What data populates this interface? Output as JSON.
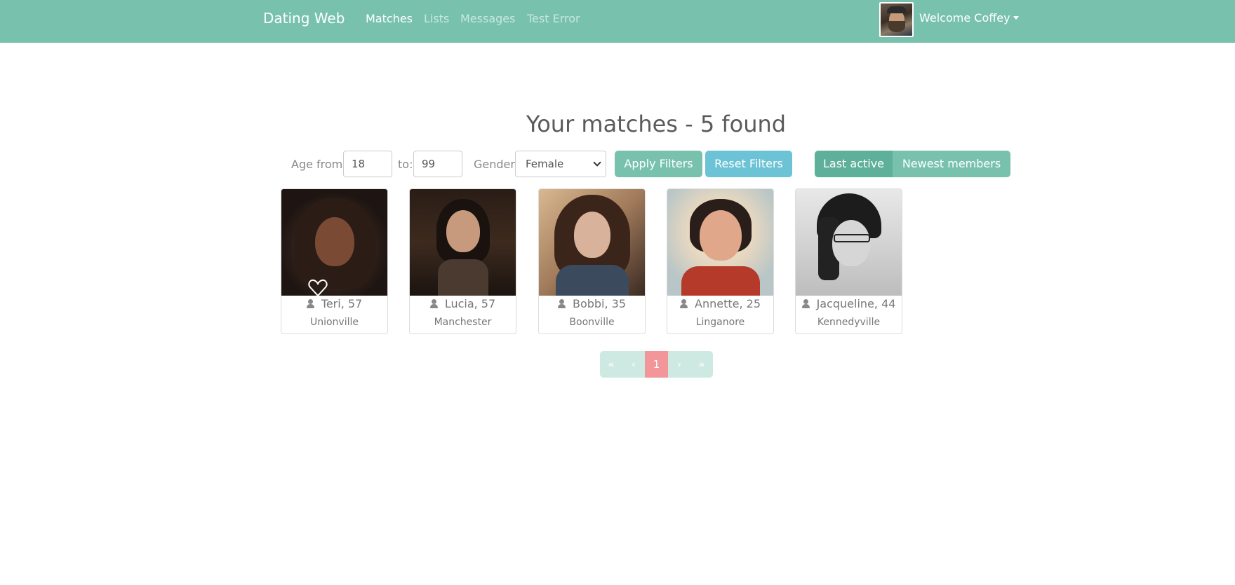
{
  "navbar": {
    "brand": "Dating Web",
    "links": [
      "Matches",
      "Lists",
      "Messages",
      "Test Error"
    ],
    "active_link": "Matches",
    "user_greeting": "Welcome Coffey"
  },
  "page": {
    "title": "Your matches - 5 found"
  },
  "filters": {
    "age_from_label": "Age from:",
    "age_from_value": "18",
    "age_to_label": "to:",
    "age_to_value": "99",
    "gender_label": "Gender:",
    "gender_value": "Female",
    "apply_label": "Apply Filters",
    "reset_label": "Reset Filters"
  },
  "sort": {
    "options": [
      "Last active",
      "Newest members"
    ],
    "selected": "Last active"
  },
  "members": [
    {
      "name": "Teri, 57",
      "city": "Unionville"
    },
    {
      "name": "Lucia, 57",
      "city": "Manchester"
    },
    {
      "name": "Bobbi, 35",
      "city": "Boonville"
    },
    {
      "name": "Annette, 25",
      "city": "Linganore"
    },
    {
      "name": "Jacqueline, 44",
      "city": "Kennedyville"
    }
  ],
  "pagination": {
    "first": "«",
    "prev": "‹",
    "current": "1",
    "next": "›",
    "last": "»"
  },
  "colors": {
    "primary": "#78c2ad",
    "info": "#6cc3d5",
    "page_active": "#f3969a"
  }
}
